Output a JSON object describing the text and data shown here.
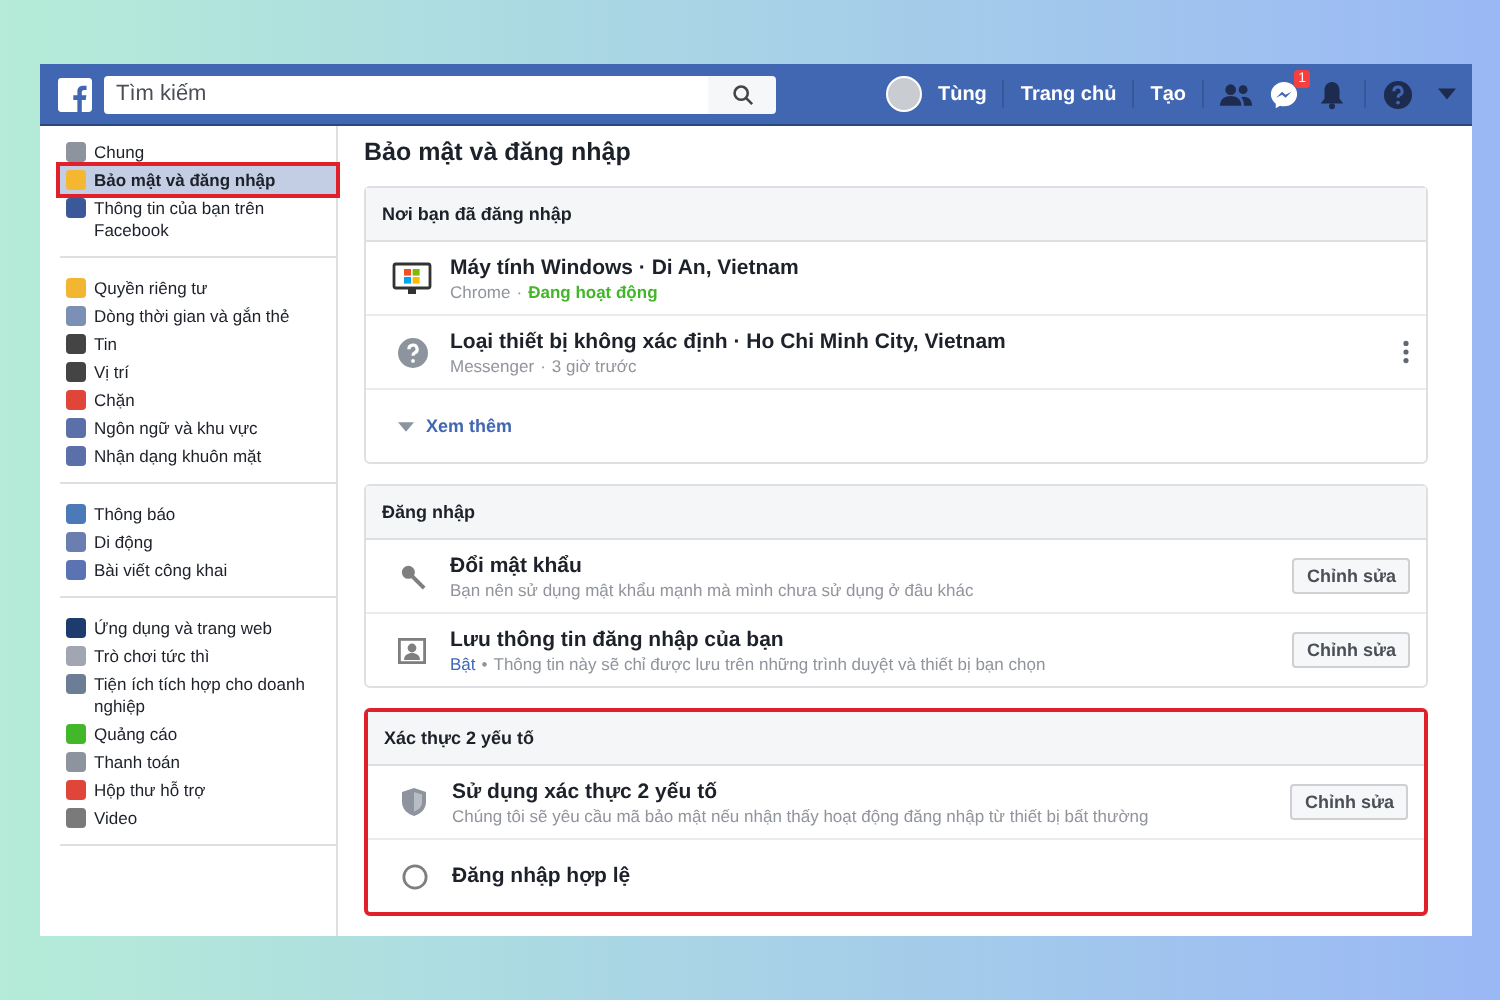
{
  "topbar": {
    "search": {
      "placeholder": "Tìm kiếm"
    },
    "user": "Tùng",
    "links": [
      "Trang chủ",
      "Tạo"
    ],
    "messages_badge": "1"
  },
  "sidebar": {
    "groups": [
      [
        {
          "label": "Chung",
          "selected": false
        },
        {
          "label": "Bảo mật và đăng nhập",
          "selected": true
        },
        {
          "label": "Thông tin của bạn trên Facebook",
          "selected": false
        }
      ],
      [
        {
          "label": "Quyền riêng tư",
          "selected": false
        },
        {
          "label": "Dòng thời gian và gắn thẻ",
          "selected": false
        },
        {
          "label": "Tin",
          "selected": false
        },
        {
          "label": "Vị trí",
          "selected": false
        },
        {
          "label": "Chặn",
          "selected": false
        },
        {
          "label": "Ngôn ngữ và khu vực",
          "selected": false
        },
        {
          "label": "Nhận dạng khuôn mặt",
          "selected": false
        }
      ],
      [
        {
          "label": "Thông báo",
          "selected": false
        },
        {
          "label": "Di động",
          "selected": false
        },
        {
          "label": "Bài viết công khai",
          "selected": false
        }
      ],
      [
        {
          "label": "Ứng dụng và trang web",
          "selected": false
        },
        {
          "label": "Trò chơi tức thì",
          "selected": false
        },
        {
          "label": "Tiện ích tích hợp cho doanh nghiệp",
          "selected": false
        },
        {
          "label": "Quảng cáo",
          "selected": false
        },
        {
          "label": "Thanh toán",
          "selected": false
        },
        {
          "label": "Hộp thư hỗ trợ",
          "selected": false
        },
        {
          "label": "Video",
          "selected": false
        }
      ]
    ]
  },
  "page_title": "Bảo mật và đăng nhập",
  "sections": [
    {
      "title": "Nơi bạn đã đăng nhập",
      "highlighted": false,
      "rows": [
        {
          "kind": "session",
          "title": "Máy tính Windows · Di An, Vietnam",
          "app": "Chrome",
          "separator": "·",
          "status": "Đang hoạt động",
          "active": true
        },
        {
          "kind": "session",
          "title": "Loại thiết bị không xác định · Ho Chi Minh City, Vietnam",
          "app": "Messenger",
          "separator": "·",
          "status": "3 giờ trước",
          "active": false
        },
        {
          "kind": "more",
          "label": "Xem thêm"
        }
      ]
    },
    {
      "title": "Đăng nhập",
      "highlighted": false,
      "rows": [
        {
          "kind": "setting",
          "title": "Đổi mật khẩu",
          "description": "Bạn nên sử dụng mật khẩu mạnh mà mình chưa sử dụng ở đâu khác",
          "button": "Chỉnh sửa"
        },
        {
          "kind": "setting",
          "title": "Lưu thông tin đăng nhập của bạn",
          "state": "Bật",
          "separator": "•",
          "description": "Thông tin này sẽ chỉ được lưu trên những trình duyệt và thiết bị bạn chọn",
          "button": "Chỉnh sửa"
        }
      ]
    },
    {
      "title": "Xác thực 2 yếu tố",
      "highlighted": true,
      "rows": [
        {
          "kind": "setting",
          "title": "Sử dụng xác thực 2 yếu tố",
          "description": "Chúng tôi sẽ yêu cầu mã bảo mật nếu nhận thấy hoạt động đăng nhập từ thiết bị bất thường",
          "button": "Chỉnh sửa"
        },
        {
          "kind": "setting",
          "title": "Đăng nhập hợp lệ"
        }
      ]
    }
  ]
}
